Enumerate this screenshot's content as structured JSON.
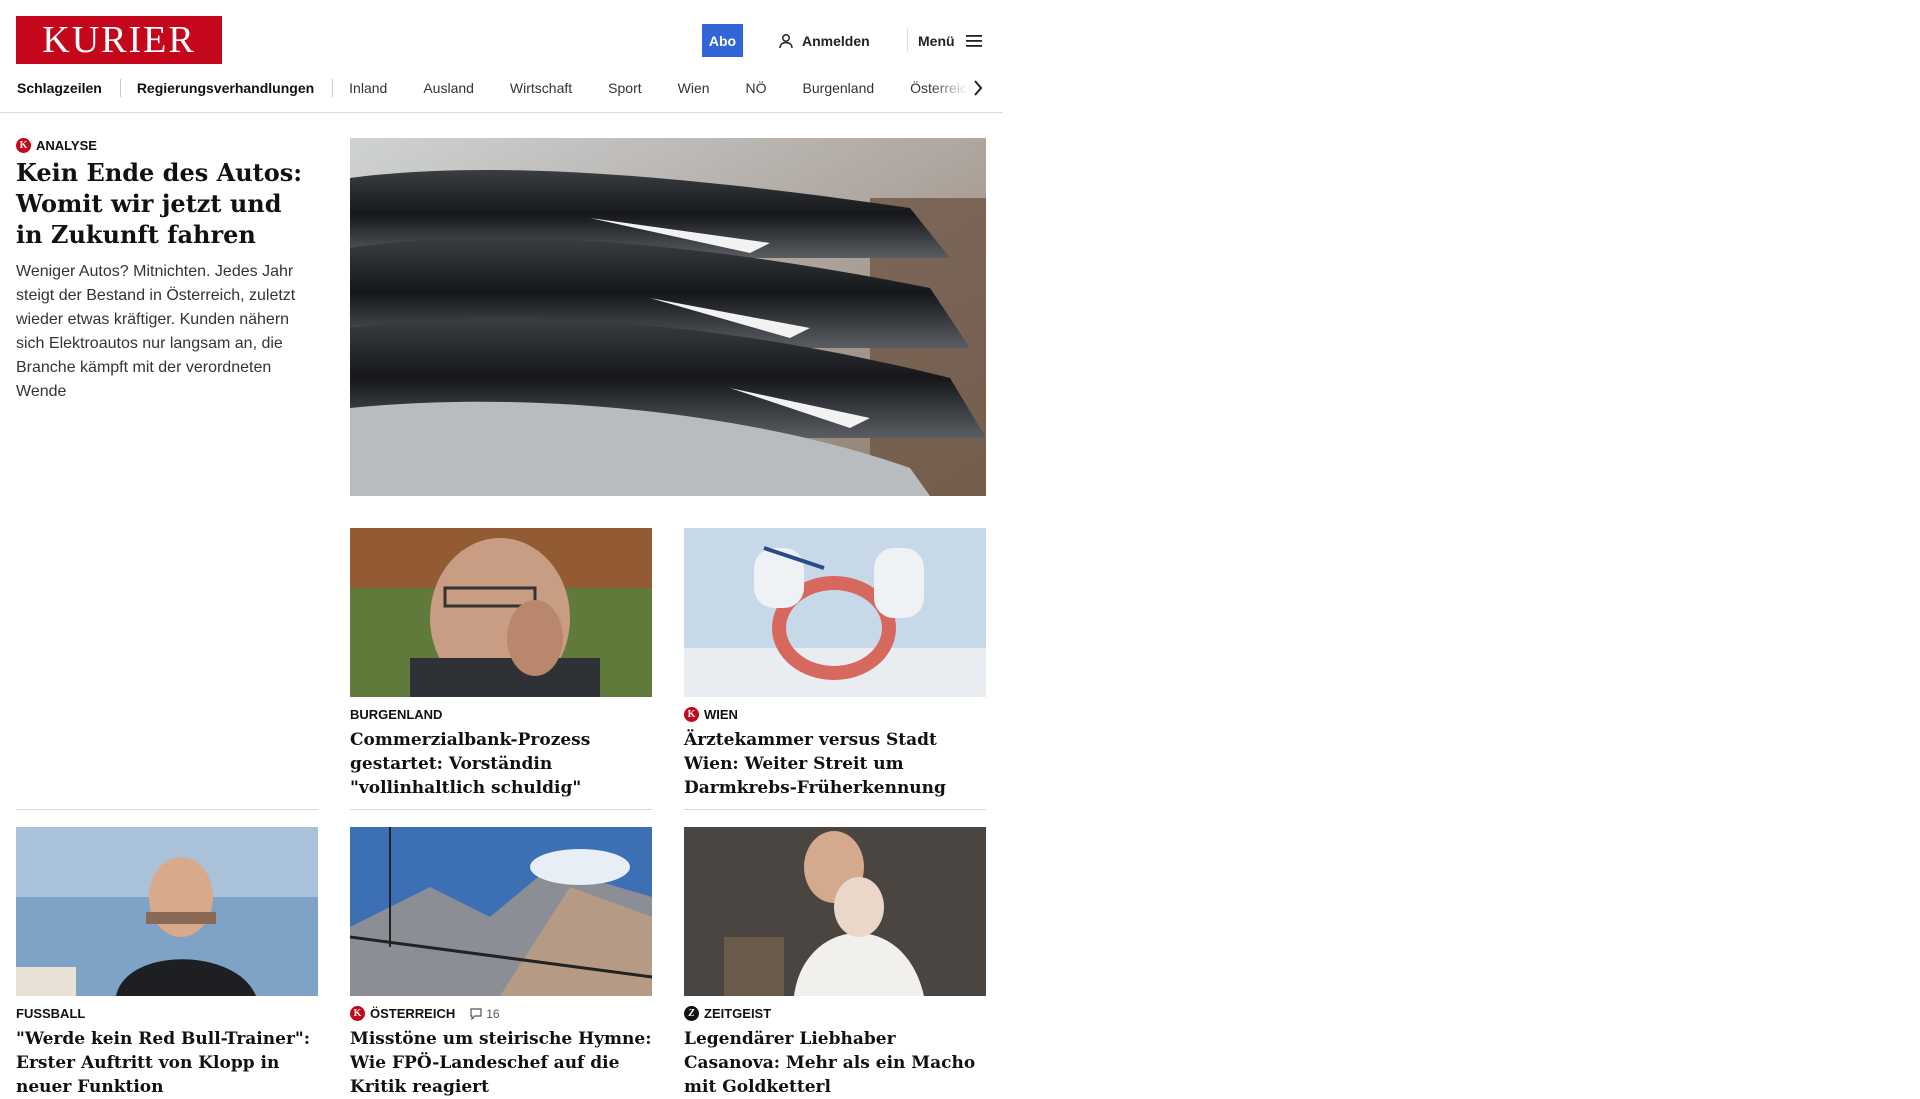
{
  "header": {
    "logo": "KURIER",
    "abo_label": "Abo",
    "login_label": "Anmelden",
    "menu_label": "Menü",
    "accent_color": "#c4071b",
    "abo_color": "#3266d6"
  },
  "nav": {
    "items": [
      "Schlagzeilen",
      "Regierungsverhandlungen",
      "Inland",
      "Ausland",
      "Wirtschaft",
      "Sport",
      "Wien",
      "NÖ",
      "Burgenland",
      "Österreich"
    ]
  },
  "lead": {
    "kicker": "Analyse",
    "kicker_icon": "kurier-plus-icon",
    "title": "Kein Ende des Autos: Womit wir jetzt und in Zukunft fahren",
    "teaser": "Weniger Autos? Mitnichten. Jedes Jahr steigt der Bestand in Österreich, zuletzt wieder etwas kräftiger. Kunden nähern sich Elektroautos nur langsam an, die Branche kämpft mit der verordneten Wende"
  },
  "cards": [
    {
      "kicker": "Burgenland",
      "title": "Commerzialbank-Prozess gestartet: Vorständin \"vollinhaltlich schuldig\""
    },
    {
      "kicker": "Wien",
      "kicker_icon": "kurier-plus-icon",
      "title": "Ärztekammer versus Stadt Wien: Weiter Streit um Darmkrebs-Früherkennung"
    },
    {
      "kicker": "Fussball",
      "title": "\"Werde kein Red Bull-Trainer\": Erster Auftritt von Klopp in neuer Funktion"
    },
    {
      "kicker": "Österreich",
      "kicker_icon": "kurier-plus-icon",
      "comments": "16",
      "title": "Misstöne um steirische Hymne: Wie FPÖ-Landeschef auf die Kritik reagiert"
    },
    {
      "kicker": "Zeitgeist",
      "kicker_icon": "zeitgeist-icon",
      "title": "Legendärer Liebhaber Casanova: Mehr als ein Macho mit Goldketterl"
    }
  ]
}
